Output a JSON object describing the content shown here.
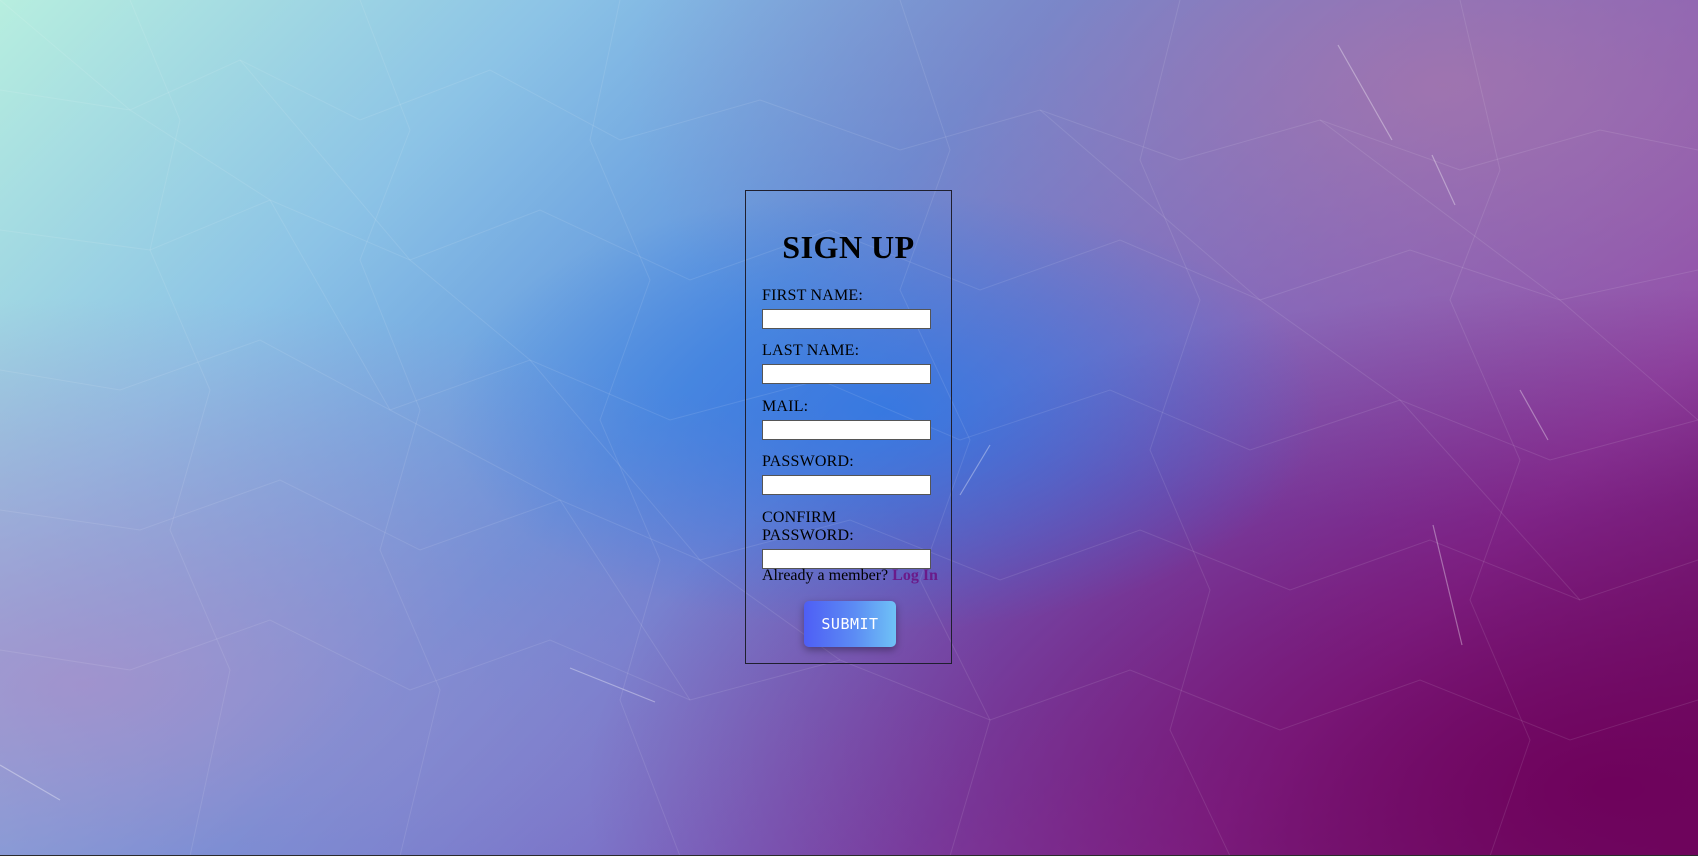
{
  "signup": {
    "title": "SIGN UP",
    "fields": [
      {
        "label": "FIRST NAME:",
        "value": "",
        "placeholder": ""
      },
      {
        "label": "LAST NAME:",
        "value": "",
        "placeholder": ""
      },
      {
        "label": "MAIL:",
        "value": "",
        "placeholder": ""
      },
      {
        "label": "PASSWORD:",
        "value": "",
        "placeholder": ""
      },
      {
        "label": "CONFIRM PASSWORD:",
        "value": "",
        "placeholder": ""
      }
    ],
    "member_prompt": "Already a member?",
    "login_link": "Log In",
    "submit_label": "SUBMIT"
  },
  "colors": {
    "login_link": "#6a1b8a",
    "submit_gradient_start": "#4e5ef5",
    "submit_gradient_end": "#6fc2f6",
    "card_border": "#1f1f2e"
  }
}
